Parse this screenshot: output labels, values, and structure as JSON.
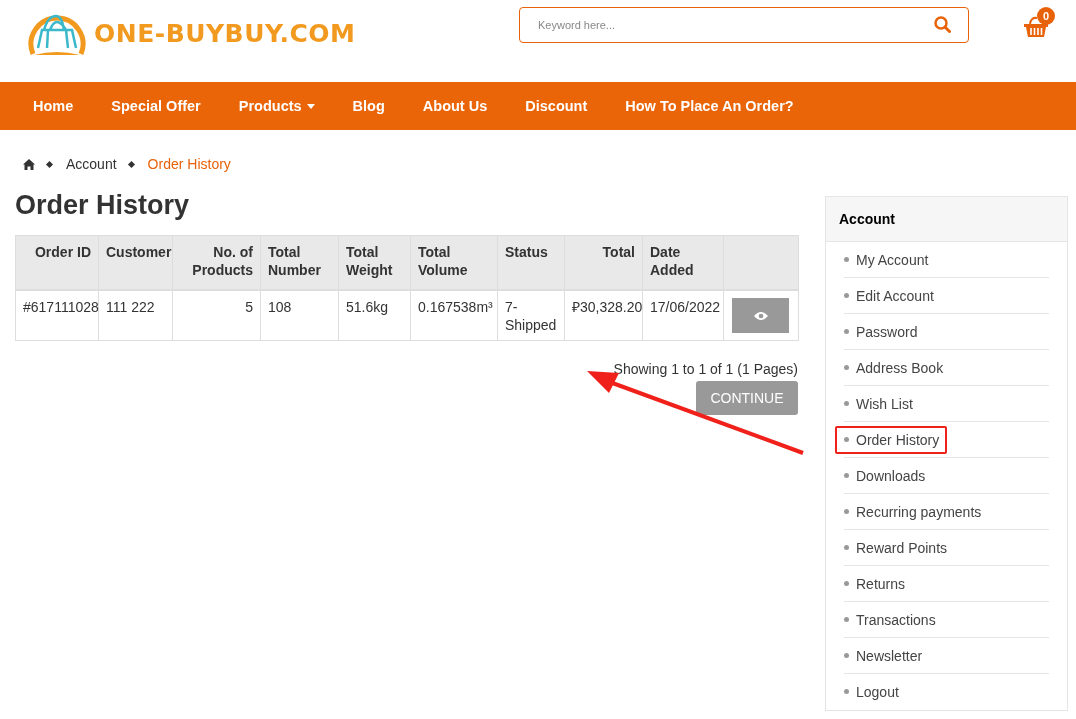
{
  "logo": {
    "text": "ONE-BUYBUY.COM"
  },
  "search": {
    "placeholder": "Keyword here..."
  },
  "cart": {
    "count": "0"
  },
  "nav": [
    {
      "label": "Home",
      "dropdown": false
    },
    {
      "label": "Special Offer",
      "dropdown": false
    },
    {
      "label": "Products",
      "dropdown": true
    },
    {
      "label": "Blog",
      "dropdown": false
    },
    {
      "label": "About Us",
      "dropdown": false
    },
    {
      "label": "Discount",
      "dropdown": false
    },
    {
      "label": "How To Place An Order?",
      "dropdown": false
    }
  ],
  "breadcrumb": [
    {
      "label": "Account",
      "selected": false
    },
    {
      "label": "Order History",
      "selected": true
    }
  ],
  "page_title": "Order History",
  "table": {
    "columns": [
      "Order ID",
      "Customer",
      "No. of Products",
      "Total Number",
      "Total Weight",
      "Total Volume",
      "Status",
      "Total",
      "Date Added"
    ],
    "rows": [
      {
        "cells": [
          "#617111028",
          "111 222",
          "5",
          "108",
          "51.6kg",
          "0.167538m³",
          "7-Shipped",
          "₽30,328.20",
          "17/06/2022"
        ]
      }
    ]
  },
  "pagination": "Showing 1 to 1 of 1 (1 Pages)",
  "continue_button": "CONTINUE",
  "sidebar": {
    "title": "Account",
    "items": [
      {
        "label": "My Account",
        "highlighted": false
      },
      {
        "label": "Edit Account",
        "highlighted": false
      },
      {
        "label": "Password",
        "highlighted": false
      },
      {
        "label": "Address Book",
        "highlighted": false
      },
      {
        "label": "Wish List",
        "highlighted": false
      },
      {
        "label": "Order History",
        "highlighted": true
      },
      {
        "label": "Downloads",
        "highlighted": false
      },
      {
        "label": "Recurring payments",
        "highlighted": false
      },
      {
        "label": "Reward Points",
        "highlighted": false
      },
      {
        "label": "Returns",
        "highlighted": false
      },
      {
        "label": "Transactions",
        "highlighted": false
      },
      {
        "label": "Newsletter",
        "highlighted": false
      },
      {
        "label": "Logout",
        "highlighted": false
      }
    ]
  }
}
